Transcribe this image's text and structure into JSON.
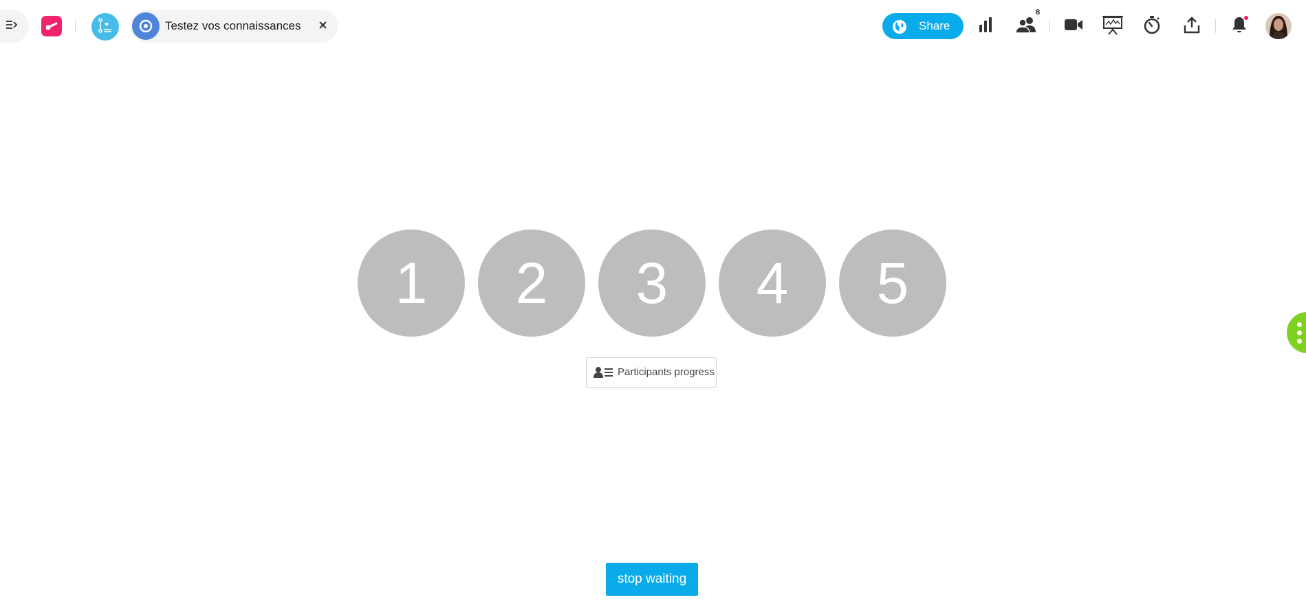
{
  "header": {
    "session_title": "Testez vos connaissances",
    "share_label": "Share",
    "participants_count": "8"
  },
  "icons": {
    "sidebar_toggle": "collapse-sidebar-icon",
    "app_logo": "app-logo-icon",
    "activity": "activity-list-icon",
    "session": "target-icon",
    "close": "close-icon",
    "share": "globe-icon",
    "results": "bar-chart-icon",
    "participants": "participants-icon",
    "video": "video-camera-icon",
    "presentation": "presentation-icon",
    "timer": "stopwatch-icon",
    "export": "upload-icon",
    "notifications": "bell-icon",
    "progress": "participant-list-icon",
    "more": "more-vertical-icon"
  },
  "questions": [
    {
      "label": "1"
    },
    {
      "label": "2"
    },
    {
      "label": "3"
    },
    {
      "label": "4"
    },
    {
      "label": "5"
    }
  ],
  "progress_button": {
    "label": "Participants progress"
  },
  "footer": {
    "stop_label": "stop waiting"
  },
  "colors": {
    "brand": "#f2226e",
    "accent": "#0aabea",
    "activity": "#45bde8",
    "session": "#4f86d9",
    "question_circle": "#bdbdbd",
    "side_handle": "#7ed321",
    "notification_dot": "#ec1e66"
  }
}
